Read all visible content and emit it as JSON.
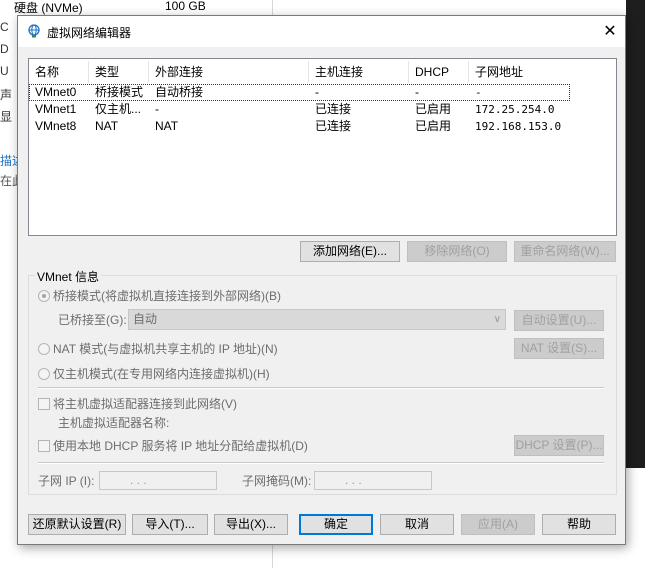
{
  "background": {
    "top_text_1": "硬盘 (NVMe)",
    "top_text_2": "100 GB",
    "side_rows": [
      "C",
      "D",
      "U",
      "声",
      "显"
    ],
    "blue_text": "描述",
    "gray_text": "在此"
  },
  "dialog": {
    "title": "虚拟网络编辑器",
    "close_glyph": "✕"
  },
  "list": {
    "columns": [
      "名称",
      "类型",
      "外部连接",
      "主机连接",
      "DHCP",
      "子网地址"
    ],
    "rows": [
      {
        "name": "VMnet0",
        "type": "桥接模式",
        "external": "自动桥接",
        "host": "-",
        "dhcp": "-",
        "subnet": "-"
      },
      {
        "name": "VMnet1",
        "type": "仅主机...",
        "external": "-",
        "host": "已连接",
        "dhcp": "已启用",
        "subnet": "172.25.254.0"
      },
      {
        "name": "VMnet8",
        "type": "NAT",
        "external": "NAT",
        "host": "已连接",
        "dhcp": "已启用",
        "subnet": "192.168.153.0"
      }
    ]
  },
  "list_buttons": {
    "add": "添加网络(E)...",
    "remove": "移除网络(O)",
    "rename": "重命名网络(W)..."
  },
  "vmnet_info": {
    "group_title": "VMnet 信息",
    "bridged_label": "桥接模式(将虚拟机直接连接到外部网络)(B)",
    "bridged_to_label": "已桥接至(G):",
    "bridged_to_value": "自动",
    "auto_settings": "自动设置(U)...",
    "nat_label": "NAT 模式(与虚拟机共享主机的 IP 地址)(N)",
    "nat_settings": "NAT 设置(S)...",
    "hostonly_label": "仅主机模式(在专用网络内连接虚拟机)(H)",
    "connect_adapter_label": "将主机虚拟适配器连接到此网络(V)",
    "adapter_name_label": "主机虚拟适配器名称:",
    "dhcp_label": "使用本地 DHCP 服务将 IP 地址分配给虚拟机(D)",
    "dhcp_settings": "DHCP 设置(P)...",
    "subnet_ip_label": "子网 IP (I):",
    "subnet_ip_value": ".   .   .",
    "subnet_mask_label": "子网掩码(M):",
    "subnet_mask_value": ".   .   ."
  },
  "footer": {
    "restore": "还原默认设置(R)",
    "import": "导入(T)...",
    "export": "导出(X)...",
    "ok": "确定",
    "cancel": "取消",
    "apply": "应用(A)",
    "help": "帮助"
  }
}
